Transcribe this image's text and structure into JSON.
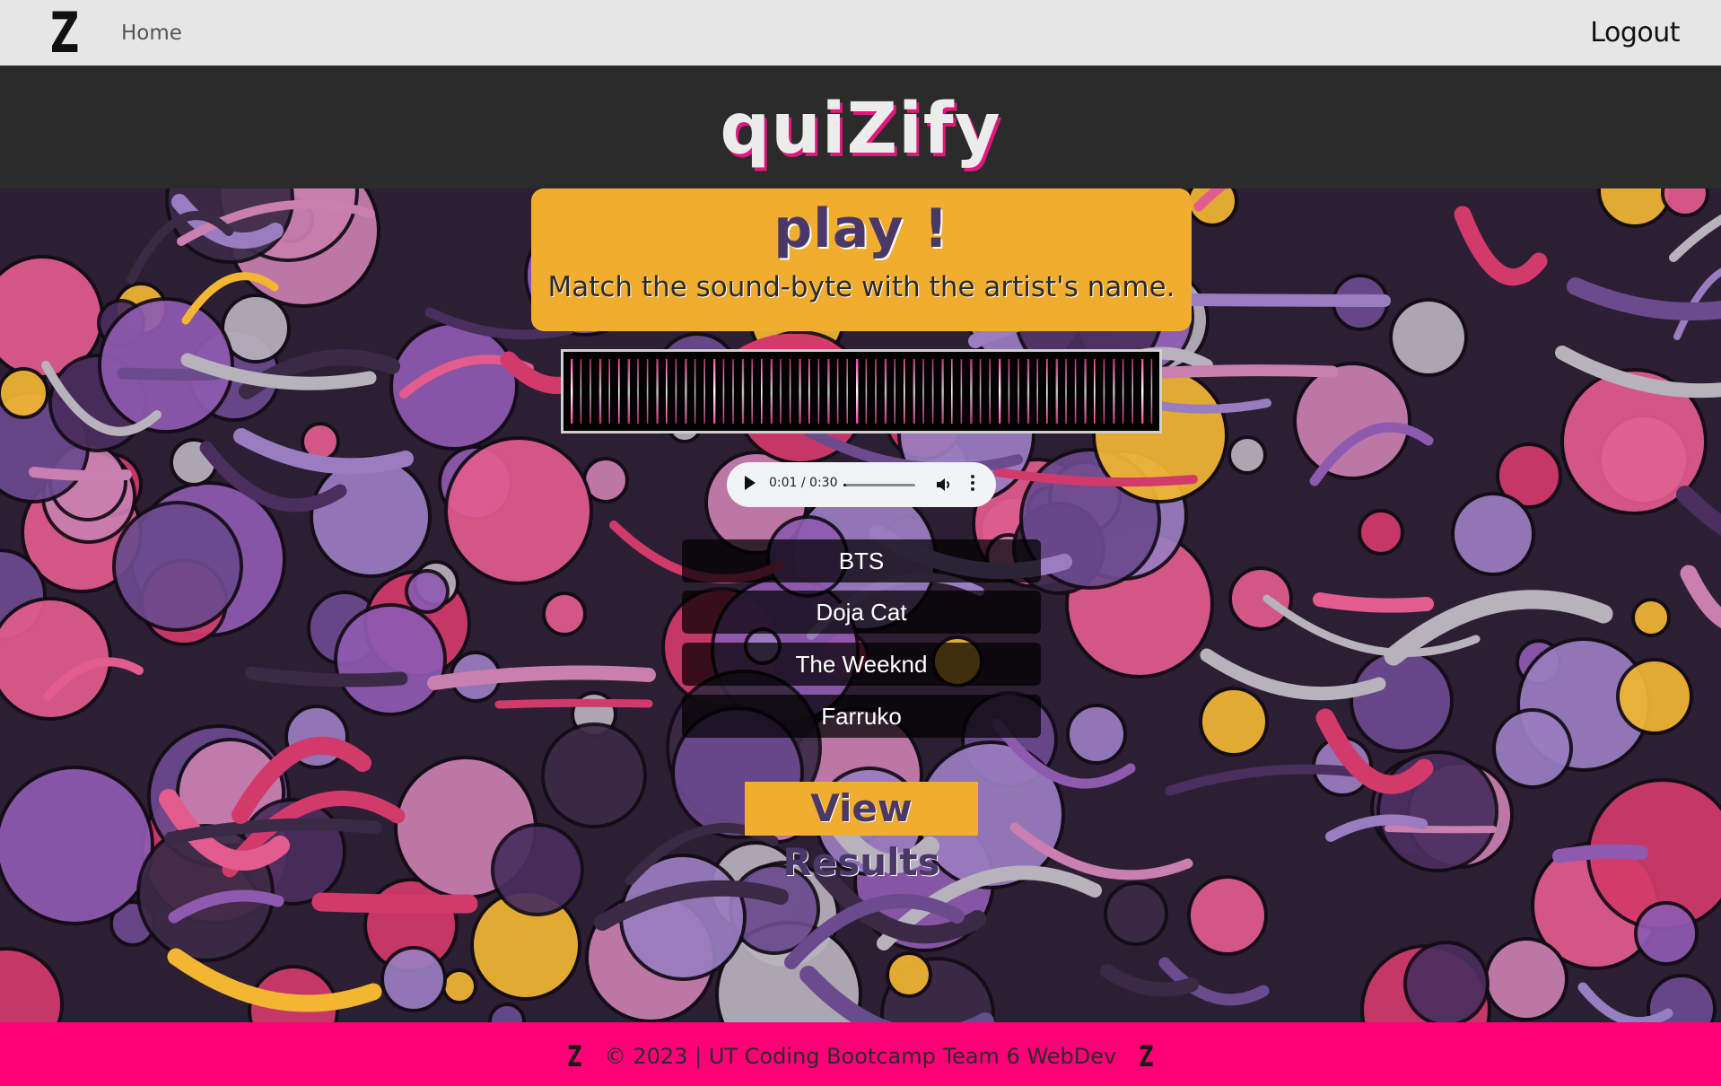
{
  "nav": {
    "logo": "Z",
    "home_label": "Home",
    "logout_label": "Logout"
  },
  "header": {
    "brand": "quiZify"
  },
  "card": {
    "title": "play !",
    "subtitle": "Match the sound-byte with the artist's name."
  },
  "player": {
    "time": "0:01 / 0:30",
    "progress": 0.033
  },
  "options": [
    "BTS",
    "Doja Cat",
    "The Weeknd",
    "Farruko"
  ],
  "results_button": "View Results",
  "footer": {
    "logo_left": "Z",
    "text": "© 2023 | UT Coding Bootcamp Team 6 WebDev",
    "logo_right": "Z"
  },
  "colors": {
    "nav_bg": "#e6e6e6",
    "header_bg": "#2b2b2b",
    "accent_orange": "#f0ad2f",
    "accent_pink": "#ff0077",
    "title_purple": "#4a3868"
  }
}
